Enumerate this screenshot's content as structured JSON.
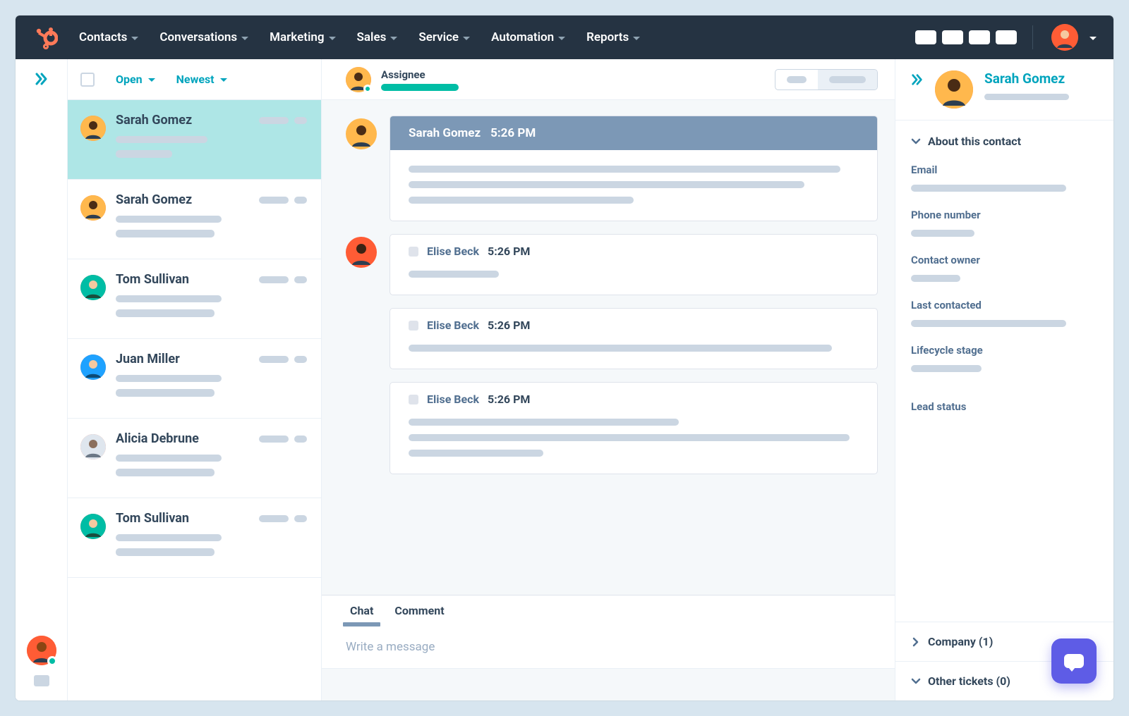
{
  "nav": {
    "items": [
      "Contacts",
      "Conversations",
      "Marketing",
      "Sales",
      "Service",
      "Automation",
      "Reports"
    ]
  },
  "filters": {
    "status": "Open",
    "sort": "Newest"
  },
  "conversations": [
    {
      "name": "Sarah Gomez",
      "selected": true,
      "avatar": "av-orange"
    },
    {
      "name": "Sarah Gomez",
      "selected": false,
      "avatar": "av-orange"
    },
    {
      "name": "Tom Sullivan",
      "selected": false,
      "avatar": "av-teal"
    },
    {
      "name": "Juan Miller",
      "selected": false,
      "avatar": "av-blue"
    },
    {
      "name": "Alicia Debrune",
      "selected": false,
      "avatar": "av-gray"
    },
    {
      "name": "Tom Sullivan",
      "selected": false,
      "avatar": "av-teal"
    }
  ],
  "thread": {
    "assignee_label": "Assignee",
    "messages_group1": {
      "author": "Sarah Gomez",
      "time": "5:26 PM"
    },
    "messages_group2": [
      {
        "author": "Elise Beck",
        "time": "5:26 PM"
      },
      {
        "author": "Elise Beck",
        "time": "5:26 PM"
      },
      {
        "author": "Elise Beck",
        "time": "5:26 PM"
      }
    ]
  },
  "compose": {
    "tabs": {
      "chat": "Chat",
      "comment": "Comment"
    },
    "placeholder": "Write a message"
  },
  "sidebar": {
    "contact_name": "Sarah Gomez",
    "about_label": "About this contact",
    "fields": {
      "email": "Email",
      "phone": "Phone number",
      "owner": "Contact owner",
      "last_contacted": "Last contacted",
      "lifecycle": "Lifecycle stage",
      "lead_status": "Lead status"
    },
    "company_label": "Company (1)",
    "tickets_label": "Other tickets (0)"
  },
  "colors": {
    "brand": "#ff7a59",
    "accent": "#00a4bd",
    "nav_bg": "#253342"
  }
}
